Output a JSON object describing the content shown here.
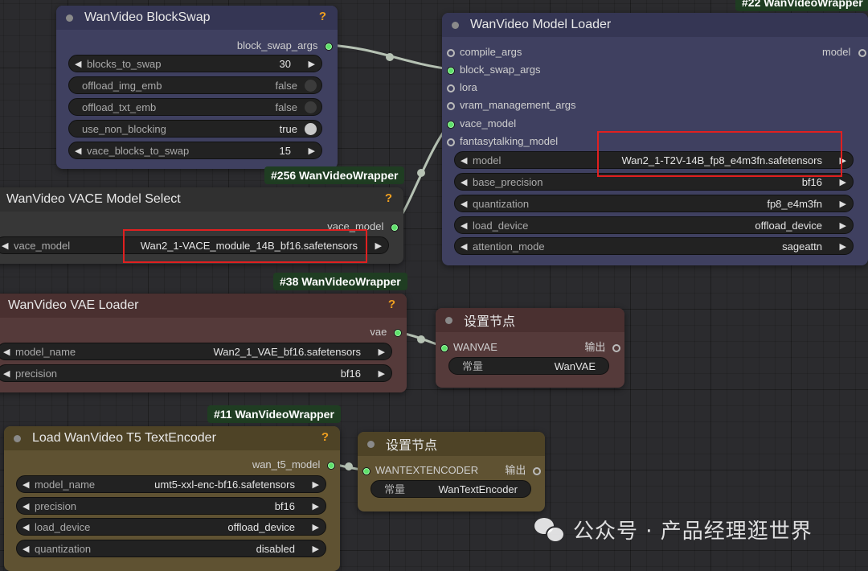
{
  "nodes": {
    "blockswap": {
      "title": "WanVideo BlockSwap",
      "help": "?",
      "output": "block_swap_args",
      "widgets": [
        {
          "label": "blocks_to_swap",
          "value": "30"
        },
        {
          "label": "offload_img_emb",
          "value": "false"
        },
        {
          "label": "offload_txt_emb",
          "value": "false"
        },
        {
          "label": "use_non_blocking",
          "value": "true"
        },
        {
          "label": "vace_blocks_to_swap",
          "value": "15"
        }
      ]
    },
    "model_loader": {
      "tag": "#22 WanVideoWrapper",
      "title": "WanVideo Model Loader",
      "inputs": [
        "compile_args",
        "block_swap_args",
        "lora",
        "vram_management_args",
        "vace_model",
        "fantasytalking_model"
      ],
      "output": "model",
      "widgets": [
        {
          "label": "model",
          "value": "Wan2_1-T2V-14B_fp8_e4m3fn.safetensors"
        },
        {
          "label": "base_precision",
          "value": "bf16"
        },
        {
          "label": "quantization",
          "value": "fp8_e4m3fn"
        },
        {
          "label": "load_device",
          "value": "offload_device"
        },
        {
          "label": "attention_mode",
          "value": "sageattn"
        }
      ]
    },
    "vace_select": {
      "tag": "#256 WanVideoWrapper",
      "title": "WanVideo VACE Model Select",
      "help": "?",
      "output": "vace_model",
      "widgets": [
        {
          "label": "vace_model",
          "value": "Wan2_1-VACE_module_14B_bf16.safetensors"
        }
      ]
    },
    "vae_loader": {
      "tag": "#38 WanVideoWrapper",
      "title": "WanVideo VAE Loader",
      "help": "?",
      "output": "vae",
      "widgets": [
        {
          "label": "model_name",
          "value": "Wan2_1_VAE_bf16.safetensors"
        },
        {
          "label": "precision",
          "value": "bf16"
        }
      ]
    },
    "set_vae": {
      "title": "设置节点",
      "input": "WANVAE",
      "output": "输出",
      "const_label": "常量",
      "const_value": "WanVAE"
    },
    "t5_loader": {
      "tag": "#11 WanVideoWrapper",
      "title": "Load WanVideo T5 TextEncoder",
      "help": "?",
      "output": "wan_t5_model",
      "widgets": [
        {
          "label": "model_name",
          "value": "umt5-xxl-enc-bf16.safetensors"
        },
        {
          "label": "precision",
          "value": "bf16"
        },
        {
          "label": "load_device",
          "value": "offload_device"
        },
        {
          "label": "quantization",
          "value": "disabled"
        }
      ]
    },
    "set_text": {
      "title": "设置节点",
      "input": "WANTEXTENCODER",
      "output": "输出",
      "const_label": "常量",
      "const_value": "WanTextEncoder"
    }
  },
  "watermark": "公众号 · 产品经理逛世界",
  "colors": {
    "accent_green": "#5ee06a",
    "highlight_red": "#e02020",
    "help_orange": "#f0a020"
  }
}
